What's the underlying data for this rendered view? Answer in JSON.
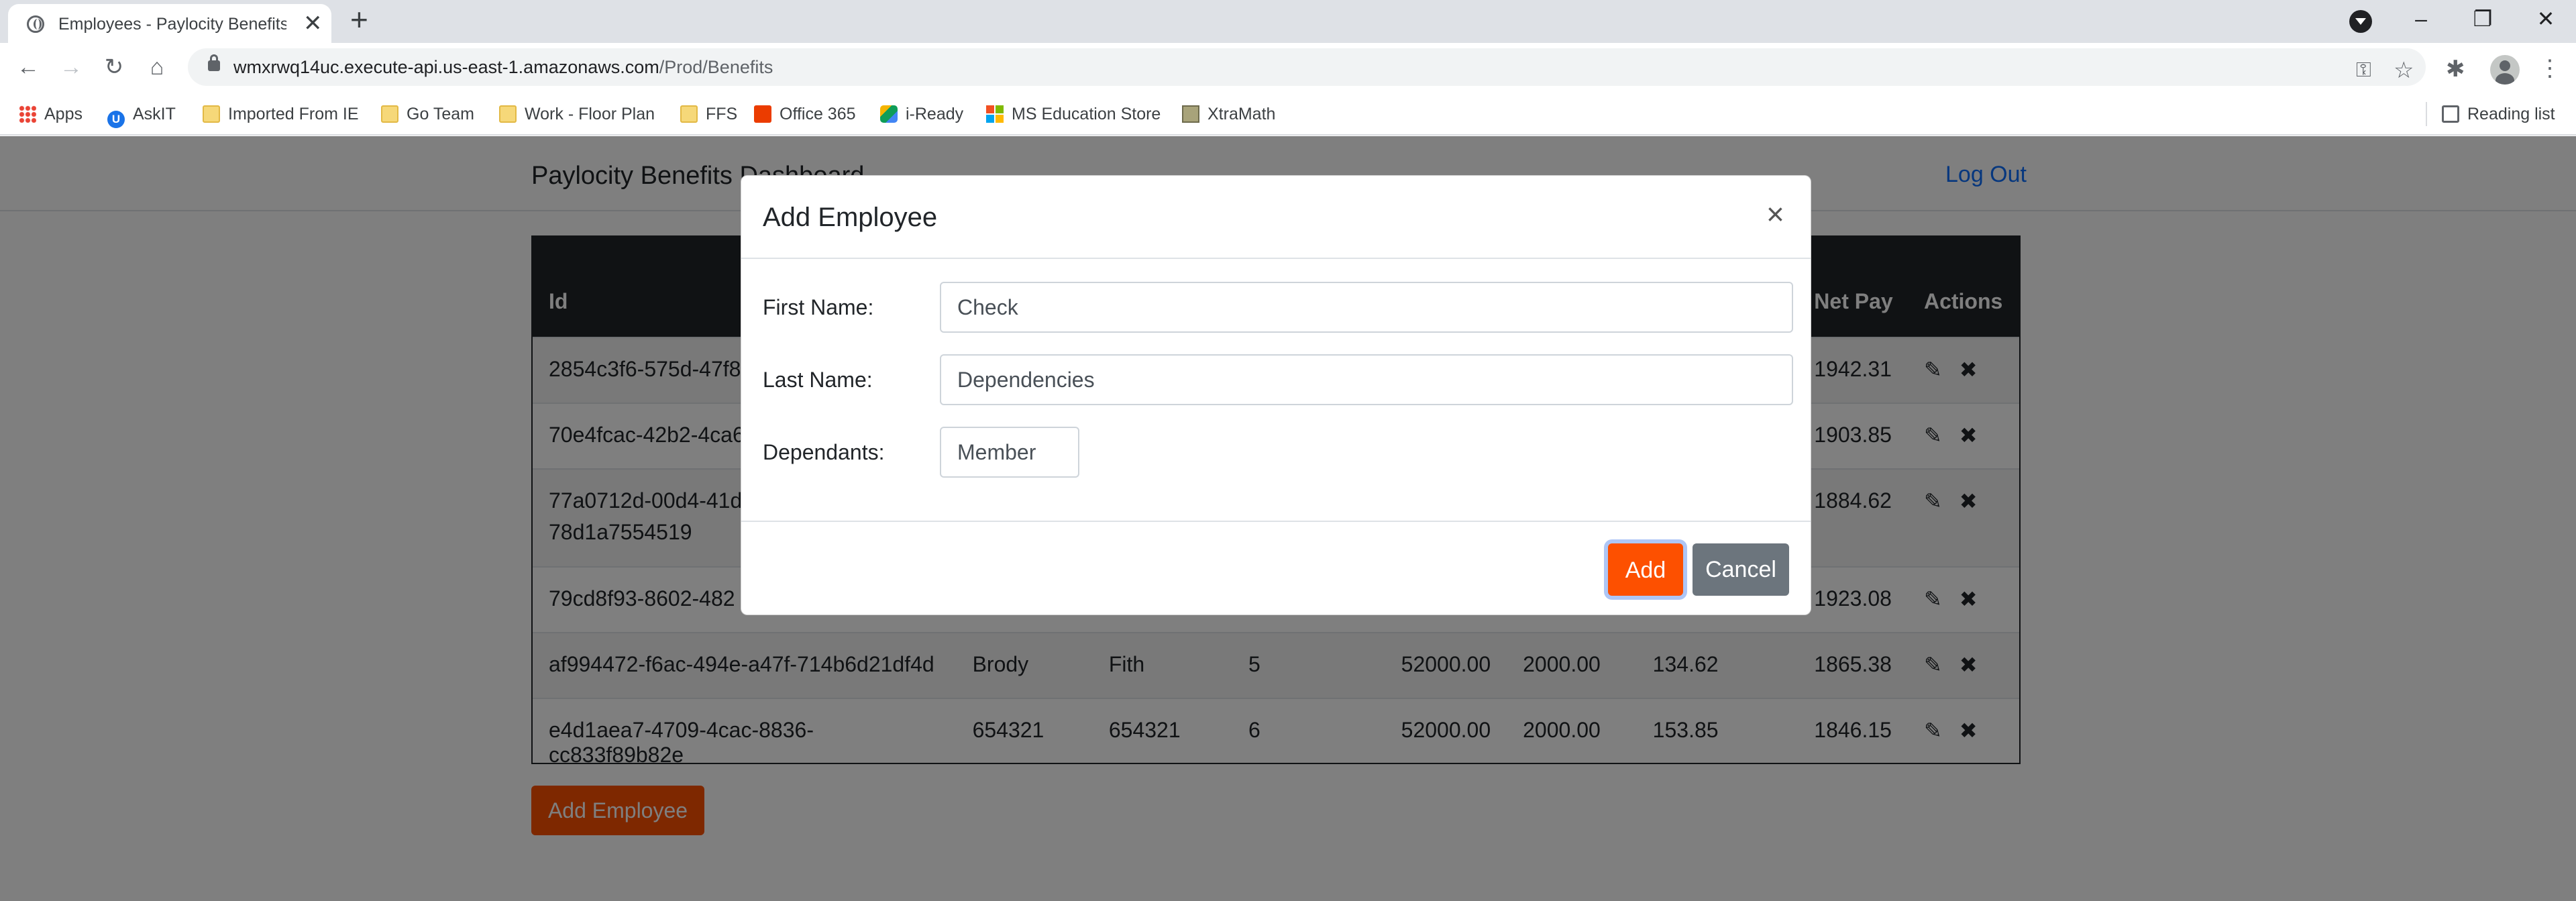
{
  "browser": {
    "tab_title": "Employees - Paylocity Benefits Dashboard",
    "tab_close": "✕",
    "new_tab": "+",
    "url_host": "wmxrwq14uc.execute-api.us-east-1.amazonaws.com",
    "url_path": "/Prod/Benefits",
    "bookmarks": [
      {
        "label": "Apps",
        "icon": "apps-grid-icon"
      },
      {
        "label": "AskIT",
        "icon": "askit-icon"
      },
      {
        "label": "Imported From IE",
        "icon": "folder-icon"
      },
      {
        "label": "Go Team",
        "icon": "folder-icon"
      },
      {
        "label": "Work - Floor Plan",
        "icon": "folder-icon"
      },
      {
        "label": "FFS",
        "icon": "folder-icon"
      },
      {
        "label": "Office 365",
        "icon": "office-365-icon"
      },
      {
        "label": "i-Ready",
        "icon": "i-ready-icon"
      },
      {
        "label": "MS Education Store",
        "icon": "microsoft-icon"
      },
      {
        "label": "XtraMath",
        "icon": "xtramath-icon"
      }
    ],
    "reading_list": "Reading list"
  },
  "page": {
    "brand": "Paylocity Benefits Dashboard",
    "logout": "Log Out",
    "table": {
      "headers": [
        "Id",
        "",
        "",
        "",
        "",
        "",
        "",
        "Net Pay",
        "Actions"
      ],
      "rows": [
        {
          "id": "2854c3f6-575d-47f8",
          "first": "",
          "last": "",
          "dependants": "",
          "salary": "",
          "gross": "",
          "benefits": "",
          "net": "1942.31"
        },
        {
          "id": "70e4fcac-42b2-4ca6",
          "first": "",
          "last": "",
          "dependants": "",
          "salary": "",
          "gross": "",
          "benefits": "",
          "net": "1903.85"
        },
        {
          "id": "77a0712d-00d4-41d",
          "id2": "78d1a7554519",
          "first": "",
          "last": "",
          "dependants": "",
          "salary": "",
          "gross": "",
          "benefits": "",
          "net": "1884.62"
        },
        {
          "id": "79cd8f93-8602-482",
          "first": "",
          "last": "",
          "dependants": "",
          "salary": "",
          "gross": "",
          "benefits": "",
          "net": "1923.08"
        },
        {
          "id": "af994472-f6ac-494e-a47f-714b6d21df4d",
          "first": "Brody",
          "last": "Fith",
          "dependants": "5",
          "salary": "52000.00",
          "gross": "2000.00",
          "benefits": "134.62",
          "net": "1865.38"
        },
        {
          "id": "e4d1aea7-4709-4cac-8836-cc833f89b82e",
          "first": "654321",
          "last": "654321",
          "dependants": "6",
          "salary": "52000.00",
          "gross": "2000.00",
          "benefits": "153.85",
          "net": "1846.15"
        }
      ]
    },
    "add_employee": "Add Employee"
  },
  "modal": {
    "title": "Add Employee",
    "close": "×",
    "first_name_label": "First Name:",
    "first_name_value": "Check",
    "last_name_label": "Last Name:",
    "last_name_value": "Dependencies",
    "dependants_label": "Dependants:",
    "dependants_value": "Member",
    "add_label": "Add",
    "cancel_label": "Cancel"
  },
  "colors": {
    "accent": "#fd5000",
    "secondary": "#6c757d",
    "table_header": "#212529",
    "link": "#0d6efd"
  }
}
